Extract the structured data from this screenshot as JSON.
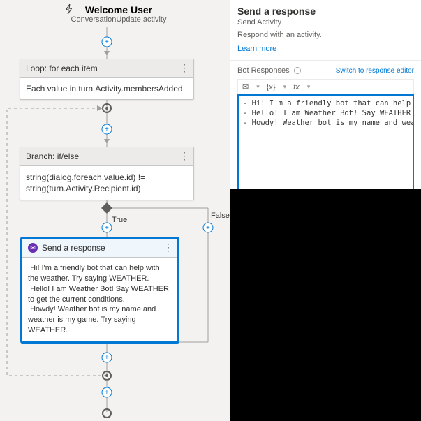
{
  "header": {
    "title": "Welcome User",
    "subtitle": "ConversationUpdate activity"
  },
  "loop": {
    "title": "Loop: for each item",
    "body": "Each value in turn.Activity.membersAdded"
  },
  "branch": {
    "title": "Branch: if/else",
    "body": "string(dialog.foreach.value.id) != string(turn.Activity.Recipient.id)",
    "trueLabel": "True",
    "falseLabel": "False"
  },
  "send": {
    "title": "Send a response",
    "body": " Hi! I'm a friendly bot that can help with the weather. Try saying WEATHER.\n Hello! I am Weather Bot! Say WEATHER to get the current conditions.\n Howdy! Weather bot is my name and weather is my game. Try saying WEATHER."
  },
  "panel": {
    "title": "Send a response",
    "subtitle": "Send Activity",
    "desc": "Respond with an activity.",
    "learnMore": "Learn more",
    "sectionLabel": "Bot Responses",
    "switchLink": "Switch to response editor",
    "toolbar": {
      "msg": "✉",
      "var": "{x}",
      "fx": "fx"
    },
    "code": "- Hi! I'm a friendly bot that can help with the weather. Try\n- Hello! I am Weather Bot! Say WEATHER to get the current con\n- Howdy! Weather bot is my name and weather is my game. Try s"
  }
}
